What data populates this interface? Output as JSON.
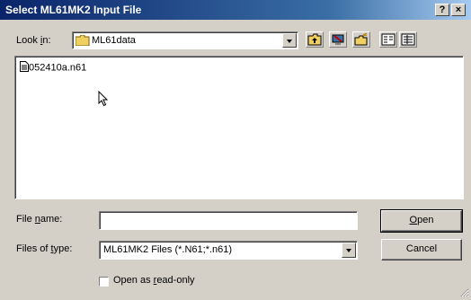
{
  "window": {
    "title": "Select ML61MK2 Input File",
    "help_button": "?",
    "close_button": "×"
  },
  "look_in": {
    "label_pre": "Look ",
    "label_mnemonic": "i",
    "label_post": "n:",
    "value": "ML61data"
  },
  "toolbar": {
    "icons": [
      "up-one-level-icon",
      "desktop-icon",
      "new-folder-icon",
      "list-view-icon",
      "details-view-icon"
    ]
  },
  "file_list": {
    "items": [
      {
        "name": "052410a.n61",
        "icon": "file-icon"
      }
    ]
  },
  "file_name": {
    "label_pre": "File ",
    "label_mnemonic": "n",
    "label_post": "ame:",
    "value": ""
  },
  "files_of_type": {
    "label_pre": "Files of ",
    "label_mnemonic": "t",
    "label_post": "ype:",
    "value": "ML61MK2 Files (*.N61;*.n61)"
  },
  "buttons": {
    "open_mnemonic": "O",
    "open_rest": "pen",
    "cancel": "Cancel"
  },
  "read_only": {
    "label_pre": "Open as ",
    "label_mnemonic": "r",
    "label_post": "ead-only",
    "checked": false
  }
}
